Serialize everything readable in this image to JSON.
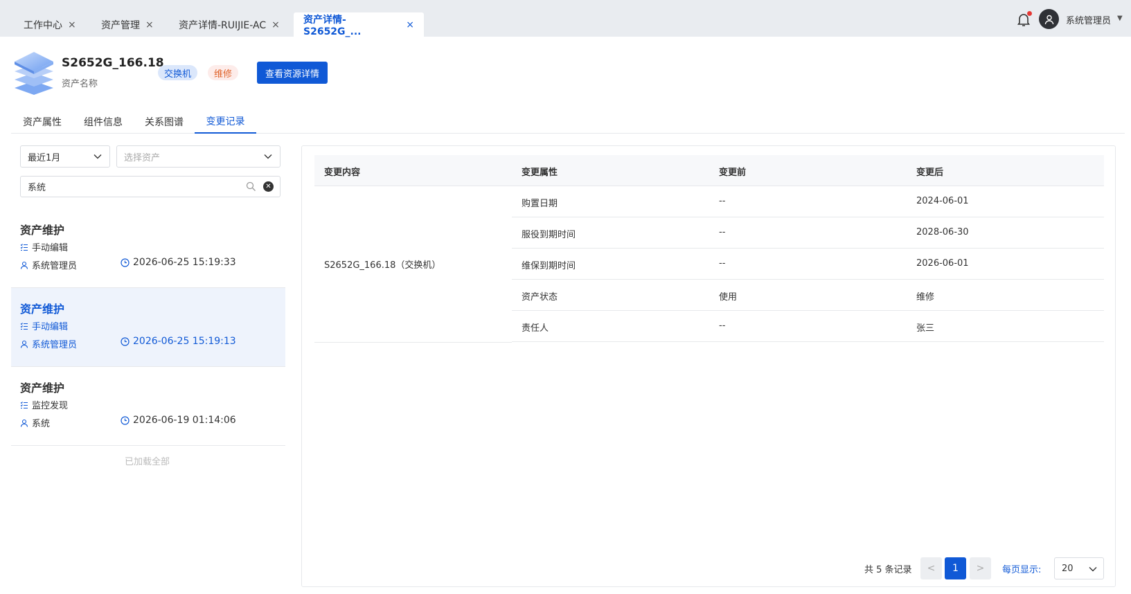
{
  "tabs": [
    {
      "label": "工作中心",
      "close": "×"
    },
    {
      "label": "资产管理",
      "close": "×"
    },
    {
      "label": "资产详情-RUIJIE-AC",
      "close": "×"
    },
    {
      "label": "资产详情-S2652G_...",
      "close": "×",
      "active": true
    }
  ],
  "user": {
    "name": "系统管理员",
    "notification_icon": "bell-icon",
    "avatar_icon": "user-icon"
  },
  "asset": {
    "name": "S2652G_166.18",
    "subtitle": "资产名称",
    "type_tag": "交换机",
    "state_tag": "维修",
    "view_button": "查看资源详情",
    "icon": "server-stack-icon"
  },
  "subtabs": [
    {
      "label": "资产属性"
    },
    {
      "label": "组件信息"
    },
    {
      "label": "关系图谱"
    },
    {
      "label": "变更记录",
      "active": true
    }
  ],
  "filters": {
    "period": "最近1月",
    "asset_placeholder": "选择资产",
    "search_value": "系统"
  },
  "records": [
    {
      "title": "资产维护",
      "method": "手动编辑",
      "user": "系统管理员",
      "time": "2026-06-25 15:19:33",
      "selected": false
    },
    {
      "title": "资产维护",
      "method": "手动编辑",
      "user": "系统管理员",
      "time": "2026-06-25 15:19:13",
      "selected": true
    },
    {
      "title": "资产维护",
      "method": "监控发现",
      "user": "系统",
      "time": "2026-06-19 01:14:06",
      "selected": false
    }
  ],
  "loaded_all": "已加载全部",
  "table": {
    "headers": [
      "变更内容",
      "变更属性",
      "变更前",
      "变更后"
    ],
    "content": "S2652G_166.18（交换机）",
    "rows": [
      {
        "attr": "购置日期",
        "before": "--",
        "after": "2024-06-01"
      },
      {
        "attr": "服役到期时间",
        "before": "--",
        "after": "2028-06-30"
      },
      {
        "attr": "维保到期时间",
        "before": "--",
        "after": "2026-06-01"
      },
      {
        "attr": "资产状态",
        "before": "使用",
        "after": "维修"
      },
      {
        "attr": "责任人",
        "before": "--",
        "after": "张三"
      }
    ]
  },
  "pagination": {
    "total": "共 5 条记录",
    "prev": "<",
    "current": "1",
    "next": ">",
    "page_size_label": "每页显示:",
    "page_size": "20"
  },
  "colors": {
    "primary": "#1059d6",
    "tag_type_bg": "#dbe7fb",
    "tag_state": "#e0642c",
    "selected_bg": "#eef3fc"
  }
}
